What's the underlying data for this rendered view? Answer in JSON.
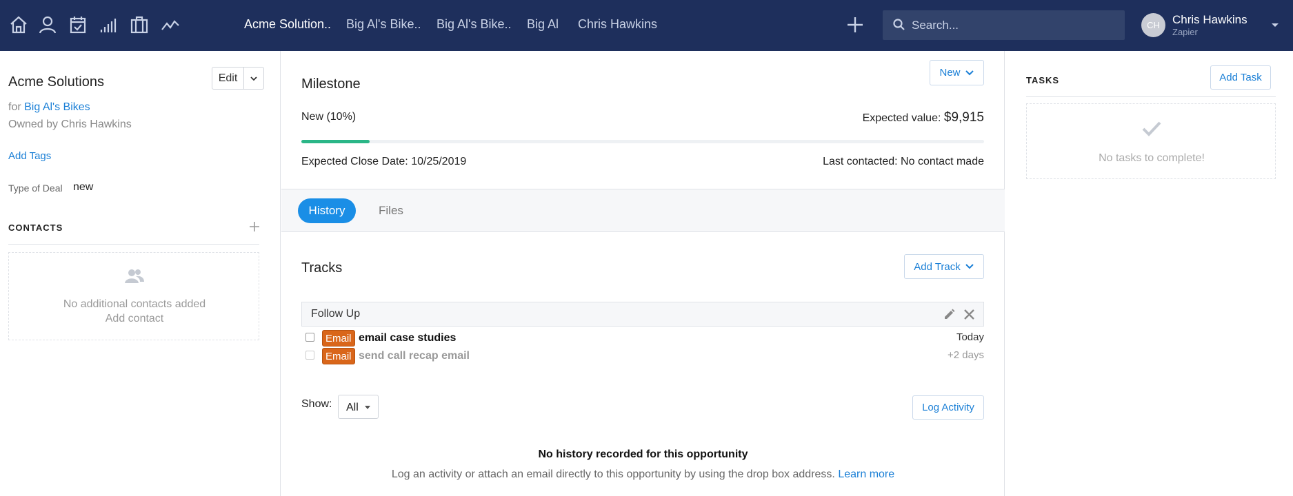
{
  "nav": {
    "icons": [
      "home-icon",
      "user-icon",
      "calendar-check-icon",
      "signal-bars-icon",
      "briefcase-icon",
      "activity-icon"
    ],
    "links": [
      "Acme Solution..",
      "Big Al's Bike..",
      "Big Al's Bike..",
      "Big Al",
      "Chris Hawkins"
    ],
    "search_placeholder": "Search...",
    "user": {
      "initials": "CH",
      "name": "Chris Hawkins",
      "org": "Zapier"
    },
    "colors": {
      "bar": "#1e2f5c",
      "search": "#32436b"
    }
  },
  "deal": {
    "title": "Acme Solutions",
    "edit_label": "Edit",
    "for_prefix": "for",
    "company": "Big Al's Bikes",
    "owner": "Owned by Chris Hawkins",
    "add_tags": "Add Tags",
    "type_label": "Type of Deal",
    "type_value": "new"
  },
  "contacts": {
    "heading": "CONTACTS",
    "empty": "No additional contacts added",
    "add": "Add contact"
  },
  "milestone": {
    "title": "Milestone",
    "status_button": "New",
    "stage": "New (10%)",
    "progress_fraction": 0.1,
    "expected_value_label": "Expected value:",
    "expected_value": "$9,915",
    "close_date": "Expected Close Date: 10/25/2019",
    "last_contacted": "Last contacted: No contact made",
    "progress_color": "#2bb687"
  },
  "tabs": [
    "History",
    "Files"
  ],
  "tracks": {
    "title": "Tracks",
    "add_button": "Add Track",
    "group": "Follow Up",
    "tasks": [
      {
        "badge": "Email",
        "name": "email case studies",
        "when": "Today"
      },
      {
        "badge": "Email",
        "name": "send call recap email",
        "when": "+2 days"
      }
    ],
    "badge_color": "#d9661a"
  },
  "history": {
    "show_label": "Show:",
    "show_value": "All",
    "log_button": "Log Activity",
    "empty_title": "No history recorded for this opportunity",
    "empty_text": "Log an activity or attach an email directly to this opportunity by using the drop box address.",
    "learn_more": "Learn more"
  },
  "tasks_panel": {
    "heading": "TASKS",
    "add_button": "Add Task",
    "empty": "No tasks to complete!"
  }
}
